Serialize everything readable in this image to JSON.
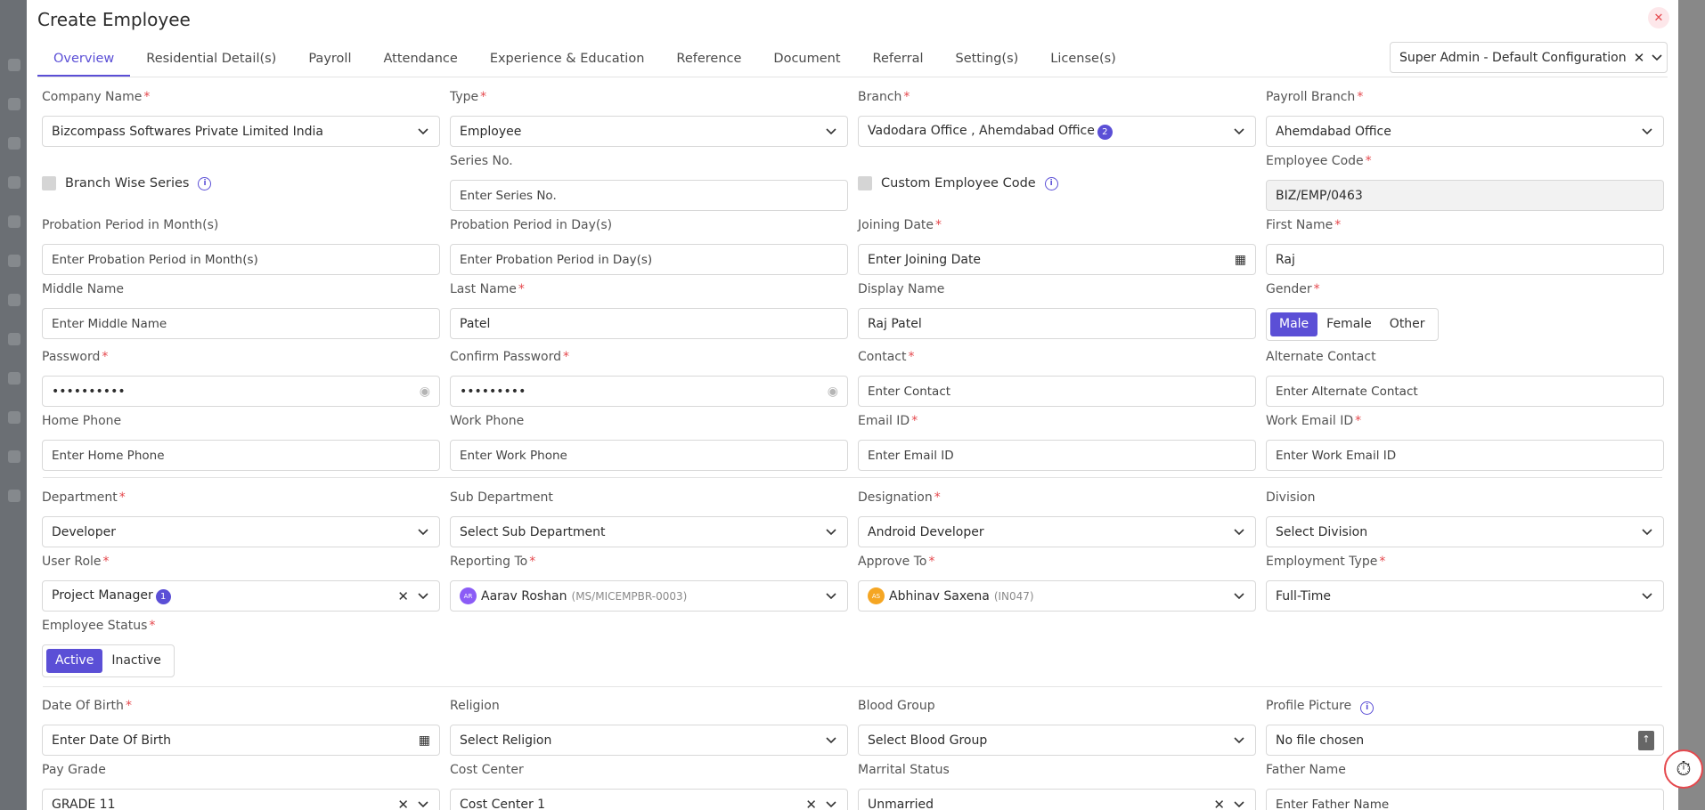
{
  "modal": {
    "title": "Create Employee"
  },
  "tabs": [
    "Overview",
    "Residential Detail(s)",
    "Payroll",
    "Attendance",
    "Experience & Education",
    "Reference",
    "Document",
    "Referral",
    "Setting(s)",
    "License(s)"
  ],
  "config": {
    "value": "Super Admin - Default Configuration"
  },
  "fields": {
    "company_name": {
      "label": "Company Name",
      "value": "Bizcompass Softwares Private Limited India"
    },
    "type": {
      "label": "Type",
      "value": "Employee"
    },
    "branch": {
      "label": "Branch",
      "value": "Vadodara Office , Ahemdabad Office",
      "count": "2"
    },
    "payroll_branch": {
      "label": "Payroll Branch",
      "value": "Ahemdabad Office"
    },
    "branch_wise_series": {
      "label": "Branch Wise Series"
    },
    "series_no": {
      "label": "Series No.",
      "placeholder": "Enter Series No."
    },
    "custom_employee_code": {
      "label": "Custom Employee Code"
    },
    "employee_code": {
      "label": "Employee Code",
      "value": "BIZ/EMP/0463"
    },
    "probation_months": {
      "label": "Probation Period in Month(s)",
      "placeholder": "Enter Probation Period in Month(s)"
    },
    "probation_days": {
      "label": "Probation Period in Day(s)",
      "placeholder": "Enter Probation Period in Day(s)"
    },
    "joining_date": {
      "label": "Joining Date",
      "placeholder": "Enter Joining Date"
    },
    "first_name": {
      "label": "First Name",
      "value": "Raj"
    },
    "middle_name": {
      "label": "Middle Name",
      "placeholder": "Enter Middle Name"
    },
    "last_name": {
      "label": "Last Name",
      "value": "Patel"
    },
    "display_name": {
      "label": "Display Name",
      "value": "Raj Patel"
    },
    "gender": {
      "label": "Gender",
      "options": [
        "Male",
        "Female",
        "Other"
      ],
      "selected": "Male"
    },
    "password": {
      "label": "Password",
      "value": "••••••••••"
    },
    "confirm_password": {
      "label": "Confirm Password",
      "value": "•••••••••"
    },
    "contact": {
      "label": "Contact",
      "placeholder": "Enter Contact"
    },
    "alternate_contact": {
      "label": "Alternate Contact",
      "placeholder": "Enter Alternate Contact"
    },
    "home_phone": {
      "label": "Home Phone",
      "placeholder": "Enter Home Phone"
    },
    "work_phone": {
      "label": "Work Phone",
      "placeholder": "Enter Work Phone"
    },
    "email_id": {
      "label": "Email ID",
      "placeholder": "Enter Email ID"
    },
    "work_email_id": {
      "label": "Work Email ID",
      "placeholder": "Enter Work Email ID"
    },
    "department": {
      "label": "Department",
      "value": "Developer"
    },
    "sub_department": {
      "label": "Sub Department",
      "placeholder": "Select Sub Department"
    },
    "designation": {
      "label": "Designation",
      "value": "Android Developer"
    },
    "division": {
      "label": "Division",
      "placeholder": "Select Division"
    },
    "user_role": {
      "label": "User Role",
      "value": "Project Manager",
      "count": "1"
    },
    "reporting_to": {
      "label": "Reporting To",
      "initials": "AR",
      "avatar_color": "#8b5cf6",
      "value": "Aarav Roshan",
      "code": "(MS/MICEMPBR-0003)"
    },
    "approve_to": {
      "label": "Approve To",
      "initials": "AS",
      "avatar_color": "#f5a623",
      "value": "Abhinav Saxena",
      "code": "(IN047)"
    },
    "employment_type": {
      "label": "Employment Type",
      "value": "Full-Time"
    },
    "employee_status": {
      "label": "Employee Status",
      "options": [
        "Active",
        "Inactive"
      ],
      "selected": "Active"
    },
    "date_of_birth": {
      "label": "Date Of Birth",
      "placeholder": "Enter Date Of Birth"
    },
    "religion": {
      "label": "Religion",
      "placeholder": "Select Religion"
    },
    "blood_group": {
      "label": "Blood Group",
      "placeholder": "Select Blood Group"
    },
    "profile_picture": {
      "label": "Profile Picture",
      "placeholder": "No file chosen"
    },
    "pay_grade": {
      "label": "Pay Grade",
      "value": "GRADE 11"
    },
    "cost_center": {
      "label": "Cost Center",
      "value": "Cost Center 1"
    },
    "marital_status": {
      "label": "Marrital Status",
      "value": "Unmarried"
    },
    "father_name": {
      "label": "Father Name",
      "placeholder": "Enter Father Name"
    }
  },
  "colors": {
    "accent": "#5b4fd6",
    "required": "#e5484d"
  }
}
